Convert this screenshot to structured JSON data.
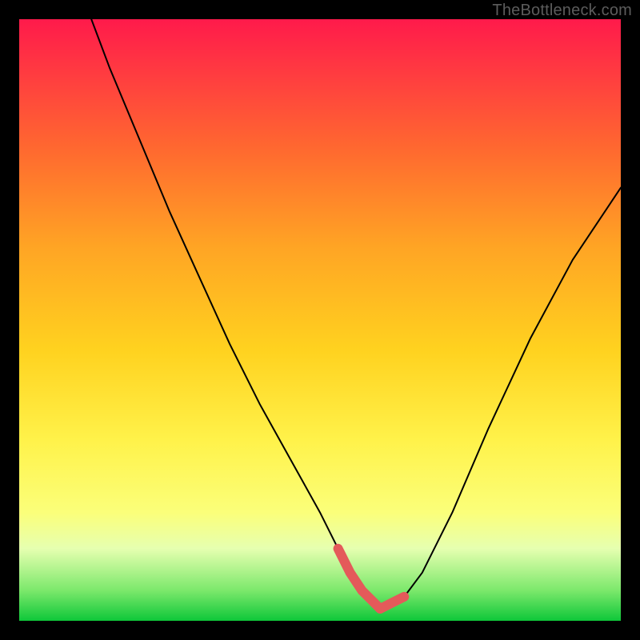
{
  "watermark": "TheBottleneck.com",
  "chart_data": {
    "type": "line",
    "title": "",
    "xlabel": "",
    "ylabel": "",
    "xlim": [
      0,
      100
    ],
    "ylim": [
      0,
      100
    ],
    "grid": false,
    "legend": false,
    "series": [
      {
        "name": "curve",
        "color": "#000000",
        "x": [
          12,
          15,
          20,
          25,
          30,
          35,
          40,
          45,
          50,
          53,
          55,
          57,
          59,
          60,
          62,
          64,
          67,
          72,
          78,
          85,
          92,
          100
        ],
        "values": [
          100,
          92,
          80,
          68,
          57,
          46,
          36,
          27,
          18,
          12,
          8,
          5,
          3,
          2,
          3,
          4,
          8,
          18,
          32,
          47,
          60,
          72
        ]
      },
      {
        "name": "highlight",
        "color": "#e45a5a",
        "x": [
          53,
          55,
          57,
          59,
          60,
          62,
          64
        ],
        "values": [
          12,
          8,
          5,
          3,
          2,
          3,
          4
        ]
      }
    ],
    "minimum": {
      "x": 60,
      "value": 2
    }
  }
}
